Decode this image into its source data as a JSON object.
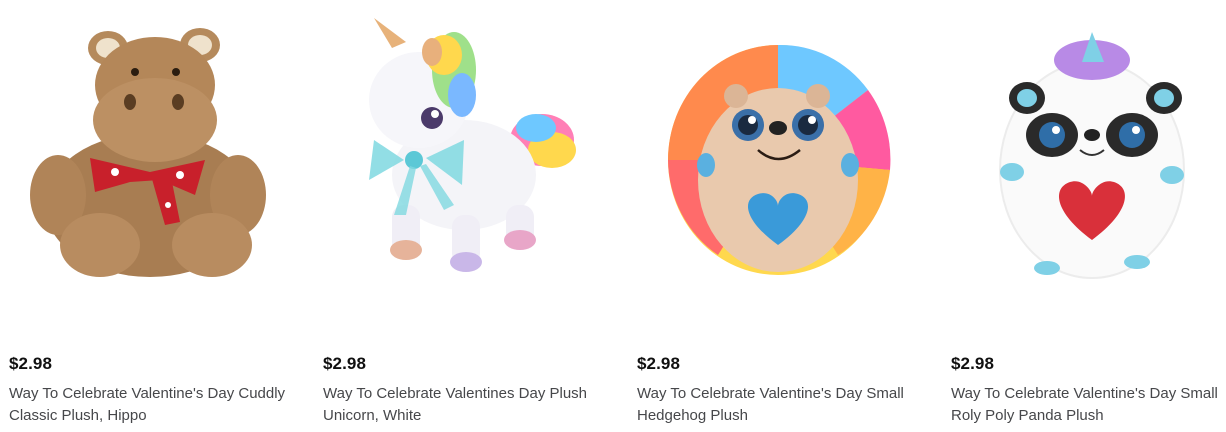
{
  "products": [
    {
      "price": "$2.98",
      "title": "Way To Celebrate Valentine's Day Cuddly Classic Plush, Hippo",
      "image": "hippo-plush-image"
    },
    {
      "price": "$2.98",
      "title": "Way To Celebrate Valentines Day Plush Unicorn, White",
      "image": "unicorn-plush-image"
    },
    {
      "price": "$2.98",
      "title": "Way To Celebrate Valentine's Day Small Hedgehog Plush",
      "image": "hedgehog-plush-image"
    },
    {
      "price": "$2.98",
      "title": "Way To Celebrate Valentine's Day Small Roly Poly Panda Plush",
      "image": "panda-plush-image"
    }
  ]
}
